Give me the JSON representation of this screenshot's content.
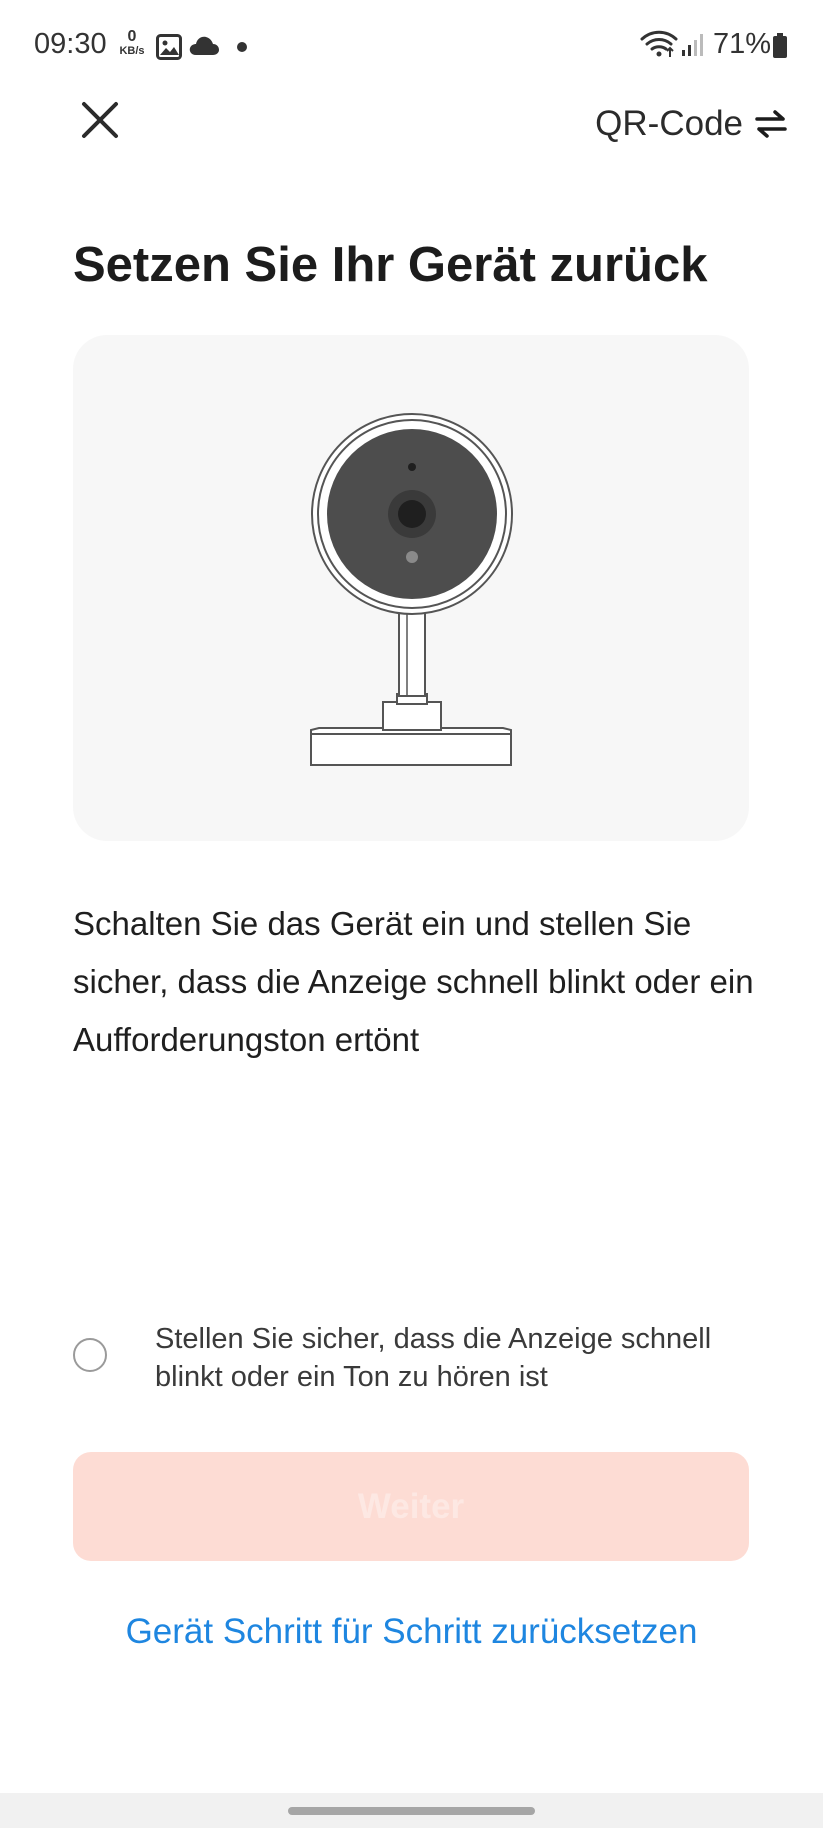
{
  "status_bar": {
    "time": "09:30",
    "net_speed_value": "0",
    "net_speed_unit": "KB/s",
    "battery_percent": "71%",
    "icons": [
      "gallery-icon",
      "cloud-icon",
      "notification-dot",
      "wifi-icon",
      "signal-icon",
      "battery-icon"
    ]
  },
  "header": {
    "close_icon": "close-icon",
    "qr_label": "QR-Code",
    "qr_icon": "swap-arrows-icon"
  },
  "page": {
    "title": "Setzen Sie Ihr Gerät zurück",
    "illustration": "security-camera-icon",
    "instruction": "Schalten Sie das Gerät ein und stellen Sie sicher, dass die Anzeige schnell blinkt oder ein Aufforderungston ertönt"
  },
  "confirm": {
    "checked": false,
    "text": "Stellen Sie sicher, dass die Anzeige schnell blinkt oder ein Ton zu hören ist"
  },
  "actions": {
    "next_label": "Weiter",
    "next_enabled": false,
    "reset_link": "Gerät Schritt für Schritt zurücksetzen"
  },
  "colors": {
    "accent_link": "#1e86e0",
    "button_disabled_bg": "#fddcd4",
    "button_disabled_text": "#fde8e3",
    "card_bg": "#f7f7f7"
  }
}
